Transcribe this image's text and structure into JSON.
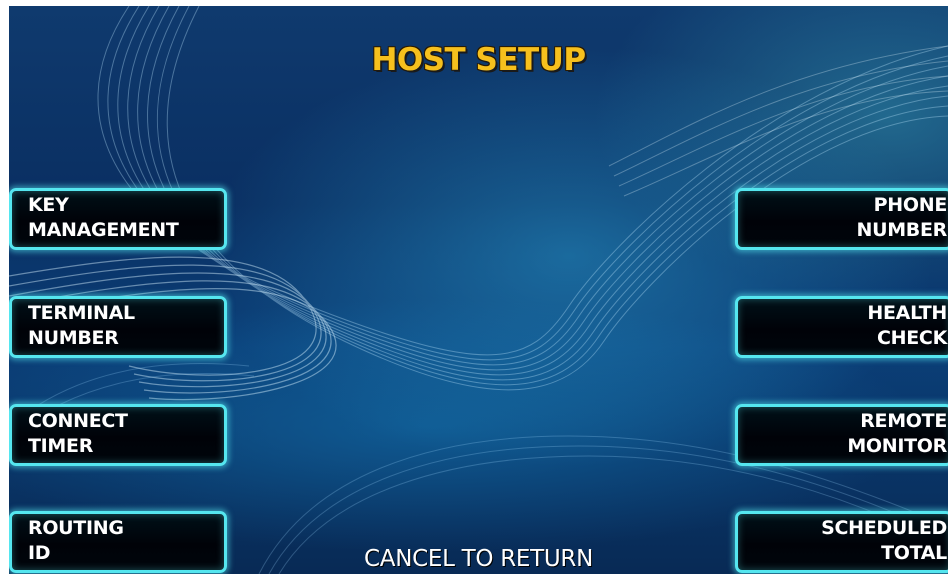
{
  "screen": {
    "title": "HOST SETUP",
    "footer": "CANCEL TO RETURN"
  },
  "left_buttons": [
    {
      "line1": "KEY",
      "line2": "MANAGEMENT"
    },
    {
      "line1": "TERMINAL",
      "line2": "NUMBER"
    },
    {
      "line1": "CONNECT",
      "line2": "TIMER"
    },
    {
      "line1": "ROUTING",
      "line2": "ID"
    }
  ],
  "right_buttons": [
    {
      "line1": "PHONE",
      "line2": "NUMBER"
    },
    {
      "line1": "HEALTH",
      "line2": "CHECK"
    },
    {
      "line1": "REMOTE",
      "line2": "MONITOR"
    },
    {
      "line1": "SCHEDULED",
      "line2": "TOTAL"
    }
  ],
  "colors": {
    "title": "#f6c01d",
    "button_border": "#55e6ef",
    "button_fill": "#000208",
    "background": "#0a2f62"
  }
}
